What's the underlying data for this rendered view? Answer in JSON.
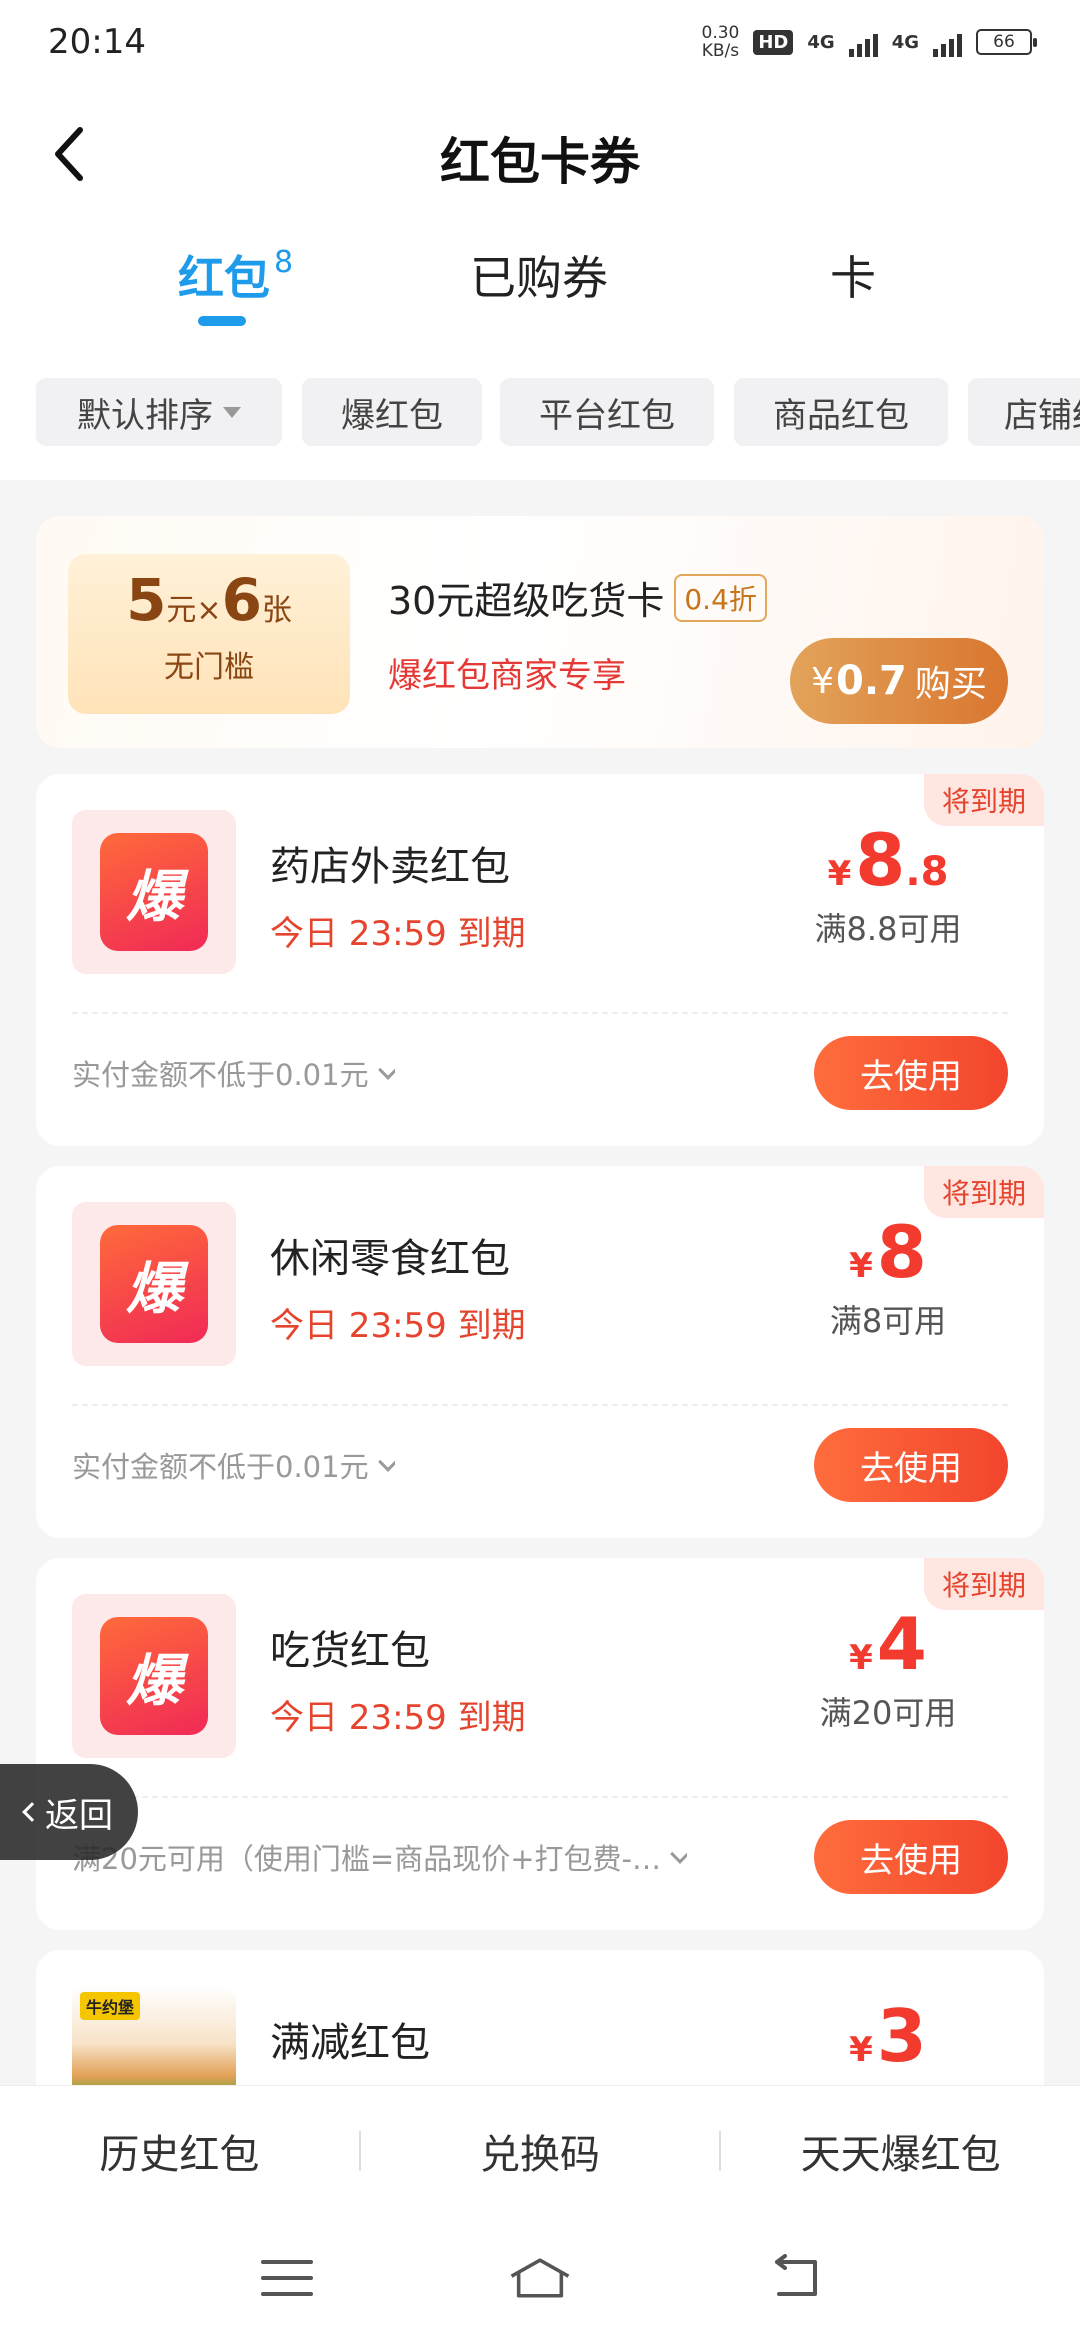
{
  "status": {
    "time": "20:14",
    "speed": "0.30",
    "speed_unit": "KB/s",
    "hd": "HD",
    "net1": "4G",
    "net2": "4G",
    "battery": "66"
  },
  "header": {
    "title": "红包卡券",
    "back_icon": "chevron-left-icon"
  },
  "tabs": [
    {
      "label": "红包",
      "badge": "8"
    },
    {
      "label": "已购券"
    },
    {
      "label": "卡"
    }
  ],
  "filters": [
    "默认排序",
    "爆红包",
    "平台红包",
    "商品红包",
    "店铺红包"
  ],
  "promo": {
    "count_a": "5",
    "unit_a": "元",
    "times": "×",
    "count_b": "6",
    "unit_b": "张",
    "threshold": "无门槛",
    "name": "30元超级吃货卡",
    "discount": "0.4折",
    "desc": "爆红包商家专享",
    "price_symbol": "¥",
    "price": "0.7",
    "buy_label": "购买"
  },
  "coupons": [
    {
      "tag": "将到期",
      "icon": "爆",
      "name": "药店外卖红包",
      "expire": "今日 23:59 到期",
      "yen": "¥",
      "amount_int": "8",
      "amount_dec": ".8",
      "condition": "满8.8可用",
      "rule": "实付金额不低于0.01元",
      "button": "去使用"
    },
    {
      "tag": "将到期",
      "icon": "爆",
      "name": "休闲零食红包",
      "expire": "今日 23:59 到期",
      "yen": "¥",
      "amount_int": "8",
      "amount_dec": "",
      "condition": "满8可用",
      "rule": "实付金额不低于0.01元",
      "button": "去使用"
    },
    {
      "tag": "将到期",
      "icon": "爆",
      "name": "吃货红包",
      "expire": "今日 23:59 到期",
      "yen": "¥",
      "amount_int": "4",
      "amount_dec": "",
      "condition": "满20可用",
      "rule": "满20元可用（使用门槛=商品现价+打包费-…",
      "button": "去使用"
    },
    {
      "icon_label": "牛约堡",
      "name": "满减红包",
      "yen": "¥",
      "amount_int": "3",
      "amount_dec": ""
    }
  ],
  "float_back": "返回",
  "bottom": [
    "历史红包",
    "兑换码",
    "天天爆红包"
  ],
  "colors": {
    "accent": "#1e9bea",
    "red": "#f23a2e",
    "gold": "#d9762f"
  }
}
